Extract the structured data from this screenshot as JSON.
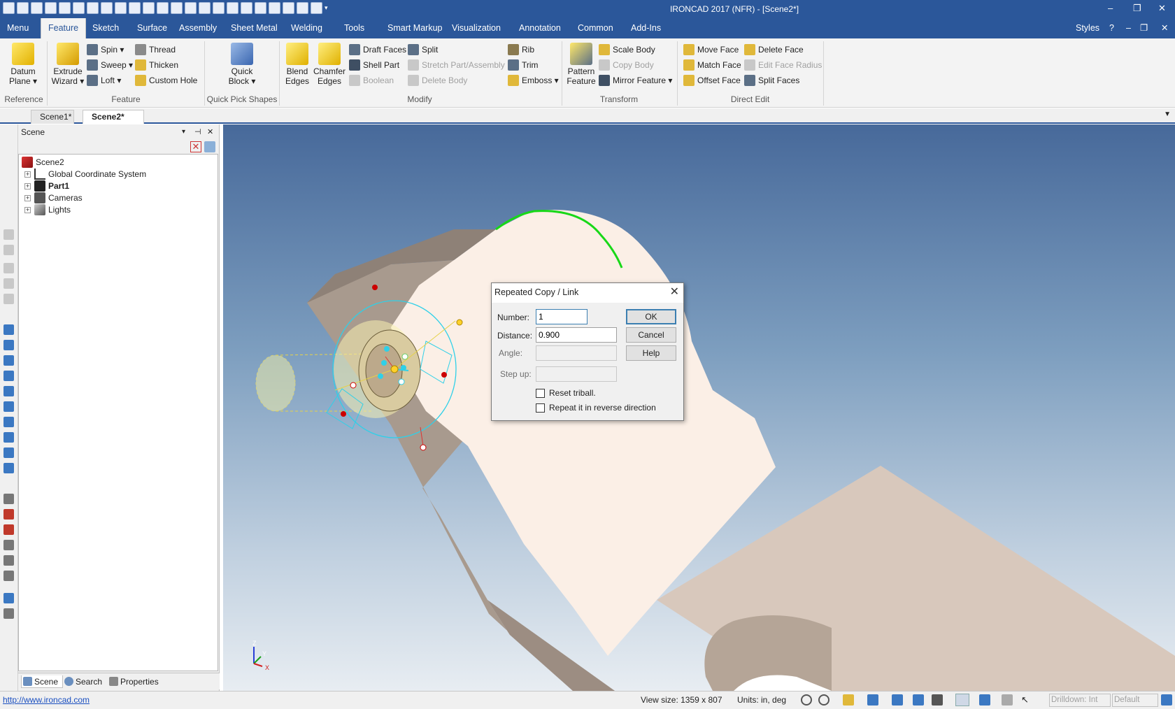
{
  "app": {
    "title": "IRONCAD 2017 (NFR) - [Scene2*]",
    "window_controls": {
      "minimize": "–",
      "restore": "❐",
      "close": "✕"
    }
  },
  "menu": {
    "tabs": [
      "Menu",
      "Feature",
      "Sketch",
      "Surface",
      "Assembly",
      "Sheet Metal",
      "Welding",
      "Tools",
      "Smart Markup",
      "Visualization",
      "Annotation",
      "Common",
      "Add-Ins"
    ],
    "active_tab": "Feature",
    "right": {
      "styles": "Styles",
      "help_icon": "?",
      "mdi_controls": [
        "–",
        "❐",
        "✕"
      ]
    }
  },
  "ribbon": {
    "groups": {
      "reference": "Reference",
      "feature": "Feature",
      "quick_pick": "Quick Pick Shapes",
      "modify": "Modify",
      "transform": "Transform",
      "direct_edit": "Direct Edit"
    },
    "reference": {
      "datum_plane": [
        "Datum",
        "Plane ▾"
      ]
    },
    "feature": {
      "extrude_wizard": [
        "Extrude",
        "Wizard ▾"
      ],
      "spin": "Spin ▾",
      "sweep": "Sweep ▾",
      "loft": "Loft ▾",
      "thread": "Thread",
      "thicken": "Thicken",
      "custom_hole": "Custom Hole"
    },
    "quick_pick": {
      "quick_block": [
        "Quick",
        "Block ▾"
      ]
    },
    "modify": {
      "blend_edges": [
        "Blend",
        "Edges"
      ],
      "chamfer_edges": [
        "Chamfer",
        "Edges"
      ],
      "draft_faces": "Draft Faces",
      "shell_part": "Shell Part",
      "boolean": "Boolean",
      "split": "Split",
      "stretch": "Stretch Part/Assembly",
      "delete_body": "Delete Body",
      "rib": "Rib",
      "trim": "Trim",
      "emboss": "Emboss ▾"
    },
    "transform": {
      "pattern_feature": [
        "Pattern",
        "Feature"
      ],
      "scale_body": "Scale Body",
      "copy_body": "Copy Body",
      "mirror_feature": "Mirror Feature ▾"
    },
    "direct_edit": {
      "move_face": "Move Face",
      "match_face": "Match Face",
      "offset_face": "Offset Face",
      "delete_face": "Delete Face",
      "edit_face_radius": "Edit Face Radius",
      "split_faces": "Split Faces"
    }
  },
  "doc_tabs": [
    "Scene1*",
    "Scene2*"
  ],
  "doc_close": "✕",
  "scene_pane": {
    "title": "Scene",
    "header_controls": {
      "dropdown": "▾",
      "pin": "⊣",
      "close": "✕"
    },
    "tree": [
      {
        "label": "Scene2",
        "bold": false
      },
      {
        "label": "Global Coordinate System",
        "bold": false
      },
      {
        "label": "Part1",
        "bold": true
      },
      {
        "label": "Cameras",
        "bold": false
      },
      {
        "label": "Lights",
        "bold": false
      }
    ],
    "bottom_tabs": [
      "Scene",
      "Search",
      "Properties"
    ]
  },
  "dialog": {
    "title": "Repeated Copy / Link",
    "number_label": "Number:",
    "number_value": "1",
    "distance_label": "Distance:",
    "distance_value": "0.900",
    "angle_label": "Angle:",
    "angle_value": "",
    "stepup_label": "Step up:",
    "stepup_value": "",
    "ok": "OK",
    "cancel": "Cancel",
    "help": "Help",
    "reset_triball": "Reset triball.",
    "reset_triball_checked": false,
    "reverse": "Repeat it in reverse direction",
    "reverse_checked": false
  },
  "triad": {
    "z": "Z",
    "y": "Y",
    "x": "X"
  },
  "status": {
    "link": "http://www.ironcad.com",
    "view_size": "View size: 1359 x  807",
    "units": "Units: in, deg",
    "drilldown": "Drilldown: Int",
    "default": "Default"
  },
  "colors": {
    "ribbon_blue": "#2b579a",
    "part_face": "#fbefe6",
    "part_side": "#a99a8e",
    "selection_cyan": "#2fd0e8",
    "highlight_green": "#18d818"
  }
}
